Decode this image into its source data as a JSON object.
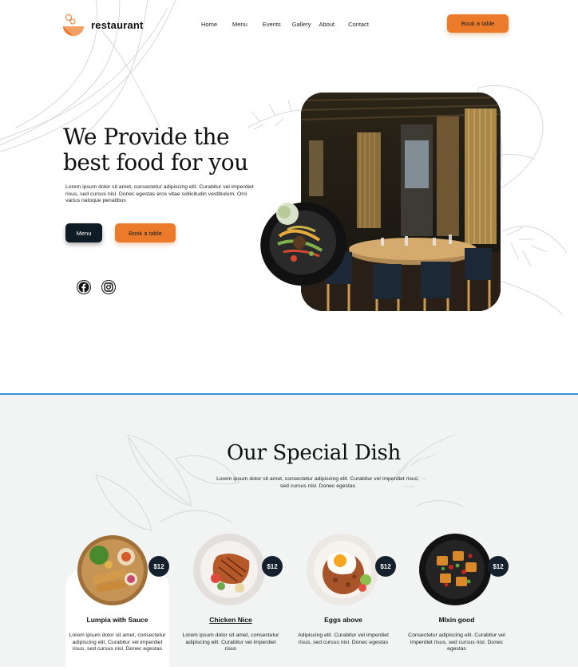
{
  "header": {
    "logo_text": "restaurant",
    "nav": [
      "Home",
      "Menu",
      "Events",
      "Gallery",
      "About",
      "Contact"
    ],
    "cta_label": "Book a table"
  },
  "hero": {
    "title_line1": "We Provide the",
    "title_line2": "best food for you",
    "description": "Lorem ipsum dolor sit amet, consectetur adipiscing elit. Curabitur vel imperdiet risus, sed cursus nisl. Donec egestas eros vitae sollicitudin vestibulum. Orci varius natoque penatibus",
    "menu_button": "Menu",
    "book_button": "Book a table",
    "social_icons": [
      "facebook-icon",
      "instagram-icon"
    ]
  },
  "special": {
    "title": "Our Special Dish",
    "description": "Lorem ipsum dolor sit amet, consectetur adipiscing elit. Curabitur vel imperdiet risus, sed cursus nisl. Donec egestas",
    "dishes": [
      {
        "name": "Lumpia with Sauce",
        "price": "$12",
        "description": "Lorem ipsum dolor sit amet, consectetur adipiscing elit. Curabitur vel imperdiet risus, sed cursus nisl. Donec egestas"
      },
      {
        "name": "Chicken Nice",
        "price": "$12",
        "description": "Lorem ipsum dolor sit amet, consectetur adipiscing elit. Curabitur vel imperdiet risus"
      },
      {
        "name": "Eggs above",
        "price": "$12",
        "description": "Adipiscing elit. Curabitur vel imperdiet risus, sed cursus nisl. Donec egestas"
      },
      {
        "name": "Mlxin good",
        "price": "$12",
        "description": "Consectetur adipiscing elit. Curabitur vel imperdiet risus, sed cursus nisl. Donec egestas"
      }
    ]
  },
  "colors": {
    "accent": "#ec7a2b",
    "dark": "#0f1b25",
    "divider": "#3b8fd9",
    "section_bg": "#f2f3f3"
  }
}
